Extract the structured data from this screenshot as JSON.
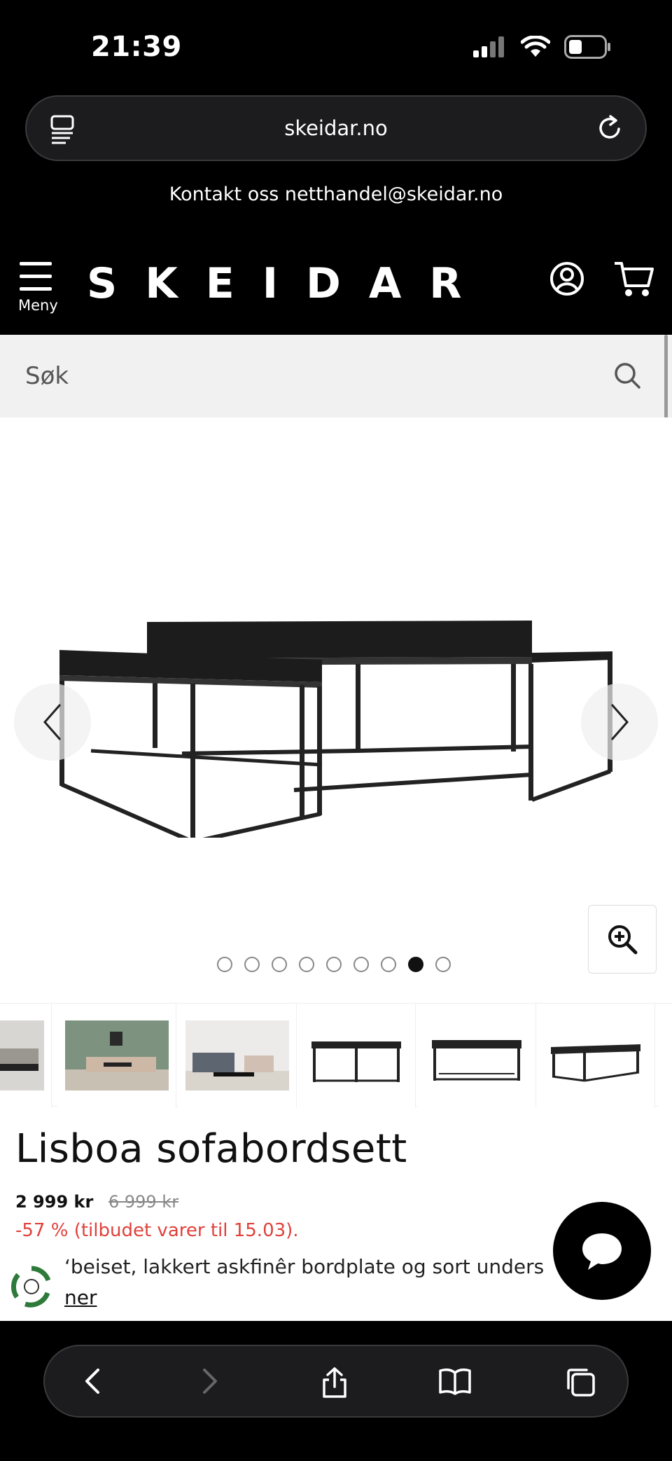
{
  "status_bar": {
    "time": "21:39"
  },
  "browser": {
    "url": "skeidar.no"
  },
  "contact": {
    "text": "Kontakt oss netthandel@skeidar.no"
  },
  "header": {
    "menu_label": "Meny",
    "logo": "SKEIDAR"
  },
  "search": {
    "placeholder": "Søk"
  },
  "gallery": {
    "dot_count": 9,
    "active_index": 7
  },
  "product": {
    "title": "Lisboa sofabordsett",
    "price": "2 999 kr",
    "old_price": "6 999 kr",
    "discount": "-57 % (tilbudet varer til 15.03).",
    "description": "‘beiset, lakkert askfinêr bordplate og sort unders",
    "more_link": "ner"
  },
  "colors": {
    "accent_red": "#e0413b",
    "header_bg": "#000000"
  },
  "icons": [
    "tabs-icon",
    "reload-icon",
    "account-icon",
    "cart-icon",
    "search-icon",
    "zoom-icon",
    "chat-icon",
    "back-icon",
    "forward-icon",
    "share-icon",
    "bookmarks-icon",
    "tabs-overview-icon"
  ]
}
